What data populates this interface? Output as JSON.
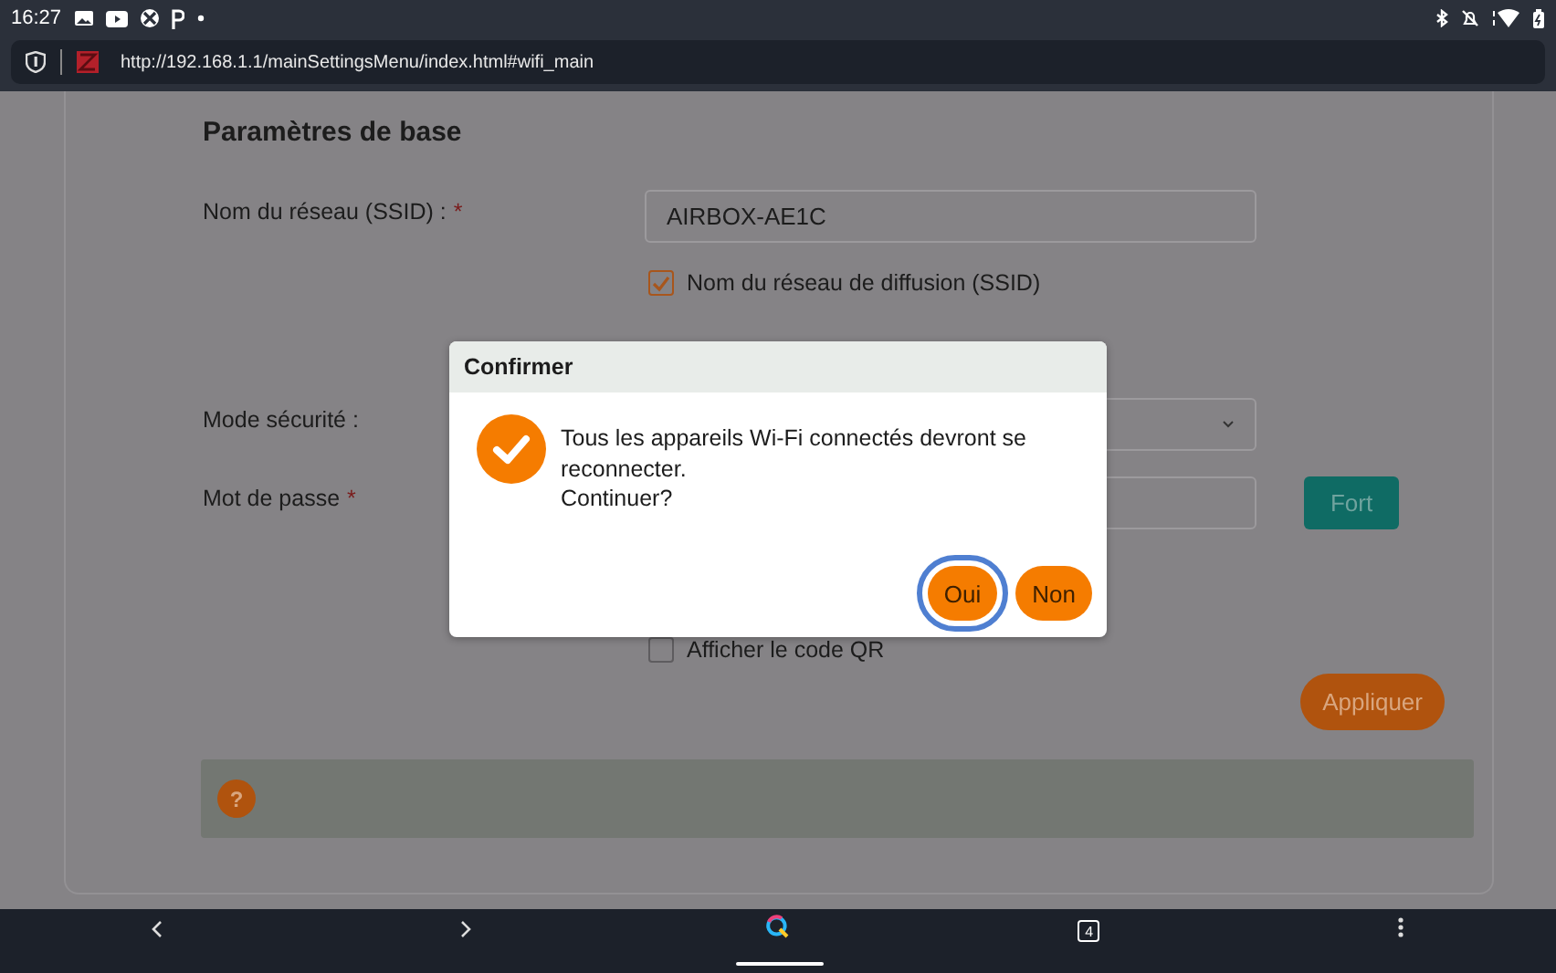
{
  "status_bar": {
    "time": "16:27"
  },
  "browser": {
    "url": "http://192.168.1.1/mainSettingsMenu/index.html#wifi_main"
  },
  "section": {
    "title": "Paramètres de base",
    "fields": [
      {
        "kind": "text",
        "label": "Nom du réseau (SSID) :",
        "required_mark": "*",
        "value": "AIRBOX-AE1C"
      },
      {
        "kind": "checkbox",
        "label": "Nom du réseau de diffusion (SSID)",
        "checked": true
      },
      {
        "kind": "select",
        "label": "Mode sécurité :"
      },
      {
        "kind": "password",
        "label": "Mot de passe",
        "required_mark": "*",
        "strength": "Fort"
      },
      {
        "kind": "checkbox",
        "label": "Afficher le code QR",
        "checked": false
      }
    ],
    "apply_button": "Appliquer",
    "help": "?"
  },
  "dialog": {
    "title": "Confirmer",
    "message": [
      "Tous les appareils Wi-Fi connectés devront se reconnecter.",
      "Continuer?"
    ],
    "buttons": [
      {
        "label": "Oui",
        "focused": true
      },
      {
        "label": "Non",
        "focused": false
      }
    ]
  },
  "nav_bar": {
    "tab_count": "4"
  }
}
